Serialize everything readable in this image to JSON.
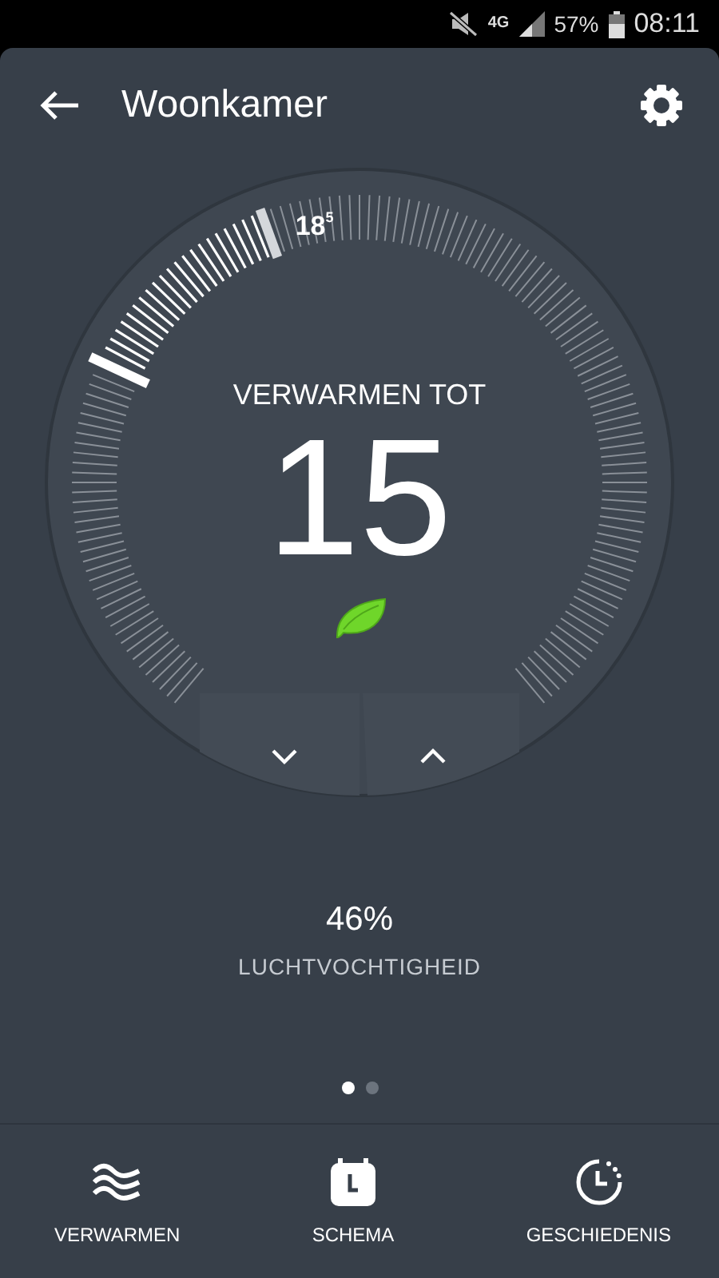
{
  "status_bar": {
    "network": "4G",
    "battery": "57%",
    "time": "08:11"
  },
  "header": {
    "title": "Woonkamer"
  },
  "dial": {
    "mode_label": "VERWARMEN TOT",
    "setpoint": "15",
    "current_temp": "18",
    "current_temp_decimal": "5",
    "eco": true
  },
  "humidity": {
    "value": "46%",
    "label": "LUCHTVOCHTIGHEID"
  },
  "pages": [
    {
      "selected": true
    },
    {
      "selected": false
    }
  ],
  "nav": [
    {
      "label": "VERWARMEN",
      "kind": "heat"
    },
    {
      "label": "SCHEMA",
      "kind": "schedule"
    },
    {
      "label": "GESCHIEDENIS",
      "kind": "history"
    }
  ]
}
